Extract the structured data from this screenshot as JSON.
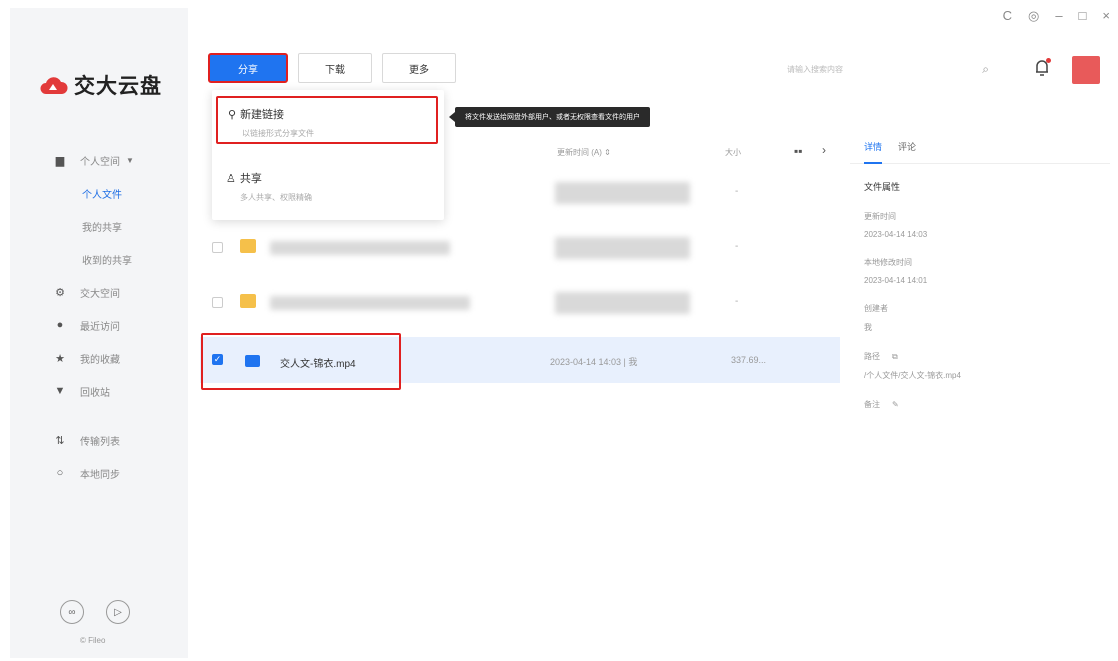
{
  "app": {
    "logo_text": "交大云盘",
    "brand_colors": {
      "primary": "#1f74f0",
      "highlight": "#e02020",
      "logo": "#e23a3a"
    }
  },
  "window_controls": {
    "refresh": "C",
    "settings": "◎",
    "minimize": "–",
    "maximize": "□",
    "close": "×"
  },
  "sidebar": {
    "items": [
      {
        "label": "个人空间",
        "icon": "document-icon",
        "caret": "▼"
      },
      {
        "label": "个人文件",
        "active": true
      },
      {
        "label": "我的共享"
      },
      {
        "label": "收到的共享"
      },
      {
        "label": "交大空间",
        "icon": "gear-icon"
      },
      {
        "label": "最近访问",
        "icon": "clock-icon"
      },
      {
        "label": "我的收藏",
        "icon": "star-icon"
      },
      {
        "label": "回收站",
        "icon": "trash-icon"
      },
      {
        "label": "传输列表",
        "icon": "transfer-icon"
      },
      {
        "label": "本地同步",
        "icon": "sync-icon"
      }
    ],
    "brand": "© Fileo"
  },
  "toolbar": {
    "share_label": "分享",
    "download_label": "下载",
    "more_label": "更多"
  },
  "search": {
    "placeholder": "请输入搜索内容"
  },
  "share_menu": {
    "new_link": {
      "title": "新建链接",
      "subtitle": "以链接形式分享文件"
    },
    "share": {
      "title": "共享",
      "subtitle": "多人共享、权限精确"
    }
  },
  "tooltip": {
    "text": "将文件发送给网盘外部用户、或者无权限查看文件的用户"
  },
  "list": {
    "columns": {
      "time": "更新时间 (A) ⇕",
      "size": "大小"
    },
    "rows": [
      {
        "size": "-"
      },
      {
        "size": "-"
      },
      {
        "size": "-"
      },
      {
        "name": "交人文-锦衣.mp4",
        "date": "2023-04-14 14:03 | 我",
        "size": "337.69..."
      }
    ]
  },
  "details": {
    "tabs": [
      "详情",
      "评论"
    ],
    "section_title": "文件属性",
    "updated_label": "更新时间",
    "updated_value": "2023-04-14 14:03",
    "modified_label": "本地修改时间",
    "modified_value": "2023-04-14 14:01",
    "creator_label": "创建者",
    "creator_value": "我",
    "path_label": "路径",
    "path_value": "/个人文件/交人文-锦衣.mp4",
    "note_label": "备注"
  }
}
